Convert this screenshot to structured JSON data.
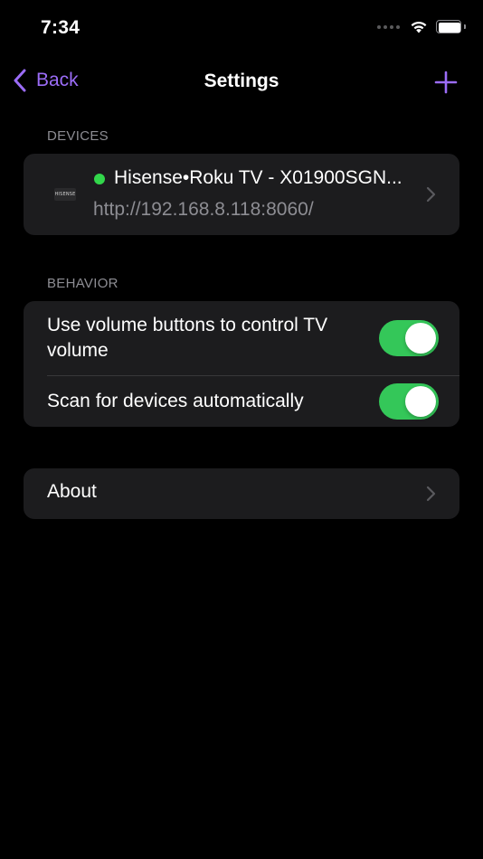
{
  "status_bar": {
    "time": "7:34"
  },
  "nav": {
    "back_label": "Back",
    "title": "Settings",
    "add_icon": "plus-icon",
    "accent_color": "#9b6cf7"
  },
  "devices_section": {
    "header": "DEVICES",
    "items": [
      {
        "name": "Hisense•Roku TV - X01900SGN...",
        "url": "http://192.168.8.118:8060/",
        "status": "online",
        "status_color": "#32d74b"
      }
    ]
  },
  "behavior_section": {
    "header": "BEHAVIOR",
    "items": [
      {
        "label": "Use volume buttons to control TV volume",
        "enabled": true
      },
      {
        "label": "Scan for devices automatically",
        "enabled": true
      }
    ]
  },
  "about": {
    "label": "About"
  },
  "colors": {
    "background": "#000000",
    "cell": "#1c1c1e",
    "switch_on": "#34c759",
    "secondary_text": "#8d8d93"
  }
}
